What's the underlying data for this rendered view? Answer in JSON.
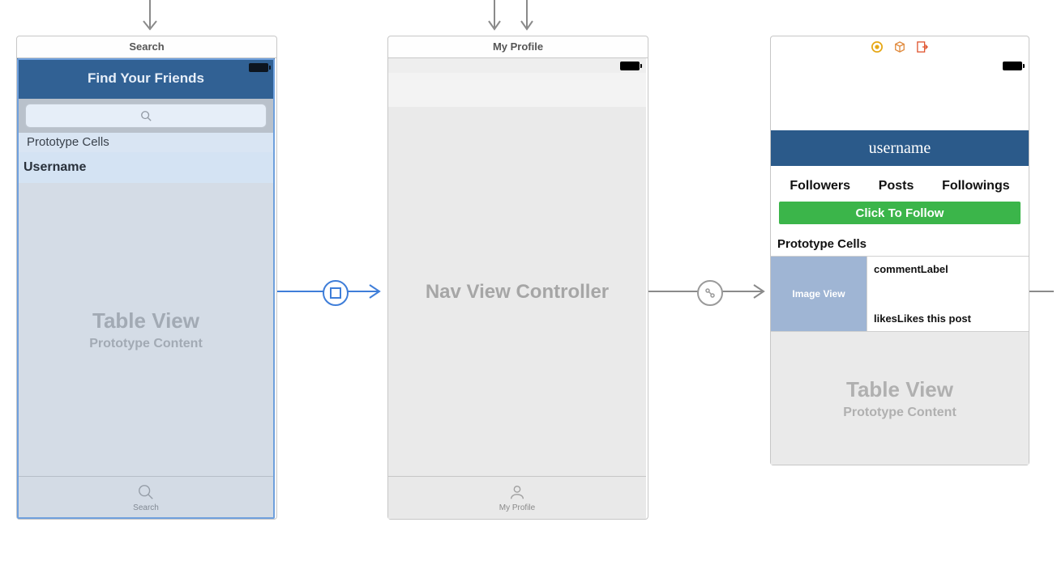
{
  "scene1": {
    "title": "Search",
    "nav_title": "Find Your Friends",
    "prototype_header": "Prototype Cells",
    "cell_label": "Username",
    "tableview_big": "Table View",
    "tableview_sub": "Prototype Content",
    "tab_label": "Search"
  },
  "scene2": {
    "title": "My Profile",
    "body_text": "Nav View Controller",
    "tab_label": "My Profile"
  },
  "scene3": {
    "username": "username",
    "followers": "Followers",
    "posts": "Posts",
    "followings": "Followings",
    "follow_btn": "Click To Follow",
    "prototype_header": "Prototype Cells",
    "image_view": "Image View",
    "comment": "commentLabel",
    "likes1": "likes",
    "likes2": "Likes this post",
    "tableview_big": "Table View",
    "tableview_sub": "Prototype Content"
  }
}
